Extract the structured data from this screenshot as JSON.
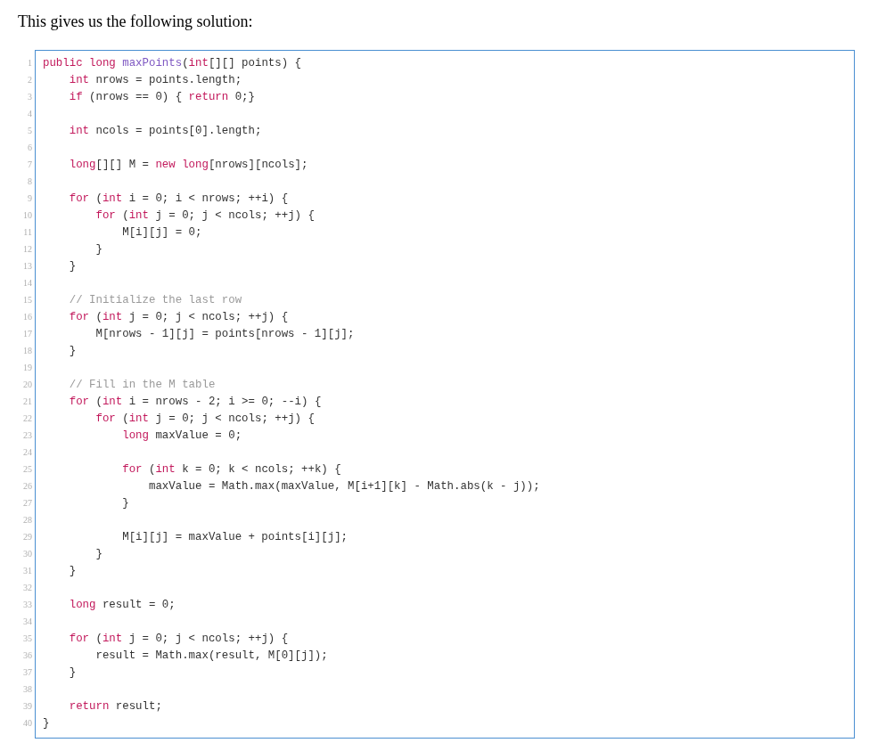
{
  "heading": "This gives us the following solution:",
  "code": {
    "lines": [
      {
        "number": "1",
        "tokens": [
          {
            "kind": "keyword",
            "text": "public"
          },
          {
            "kind": "keyword",
            "text": " long"
          },
          {
            "kind": "function",
            "text": " maxPoints"
          },
          {
            "kind": "plain",
            "text": "("
          },
          {
            "kind": "keyword",
            "text": "int"
          },
          {
            "kind": "plain",
            "text": "[][] points) {"
          }
        ]
      },
      {
        "number": "2",
        "tokens": [
          {
            "kind": "keyword",
            "text": "    int"
          },
          {
            "kind": "plain",
            "text": " nrows = points.length;"
          }
        ]
      },
      {
        "number": "3",
        "tokens": [
          {
            "kind": "keyword",
            "text": "    if"
          },
          {
            "kind": "plain",
            "text": " (nrows == 0) { "
          },
          {
            "kind": "keyword",
            "text": "return"
          },
          {
            "kind": "plain",
            "text": " 0;}"
          }
        ]
      },
      {
        "number": "4"
      },
      {
        "number": "5",
        "tokens": [
          {
            "kind": "keyword",
            "text": "    int"
          },
          {
            "kind": "plain",
            "text": " ncols = points[0].length;"
          }
        ]
      },
      {
        "number": "6"
      },
      {
        "number": "7",
        "tokens": [
          {
            "kind": "keyword",
            "text": "    long"
          },
          {
            "kind": "plain",
            "text": "[][] M = "
          },
          {
            "kind": "keyword",
            "text": "new"
          },
          {
            "kind": "keyword",
            "text": " long"
          },
          {
            "kind": "plain",
            "text": "[nrows][ncols];"
          }
        ]
      },
      {
        "number": "8"
      },
      {
        "number": "9",
        "tokens": [
          {
            "kind": "keyword",
            "text": "    for"
          },
          {
            "kind": "plain",
            "text": " ("
          },
          {
            "kind": "keyword",
            "text": "int"
          },
          {
            "kind": "plain",
            "text": " i = 0; i < nrows; ++i) {"
          }
        ]
      },
      {
        "number": "10",
        "tokens": [
          {
            "kind": "keyword",
            "text": "        for"
          },
          {
            "kind": "plain",
            "text": " ("
          },
          {
            "kind": "keyword",
            "text": "int"
          },
          {
            "kind": "plain",
            "text": " j = 0; j < ncols; ++j) {"
          }
        ]
      },
      {
        "number": "11",
        "tokens": [
          {
            "kind": "plain",
            "text": "            M[i][j] = 0;"
          }
        ]
      },
      {
        "number": "12",
        "tokens": [
          {
            "kind": "plain",
            "text": "        }"
          }
        ]
      },
      {
        "number": "13",
        "tokens": [
          {
            "kind": "plain",
            "text": "    }"
          }
        ]
      },
      {
        "number": "14"
      },
      {
        "number": "15",
        "tokens": [
          {
            "kind": "comment",
            "text": "    // Initialize the last row"
          }
        ]
      },
      {
        "number": "16",
        "tokens": [
          {
            "kind": "keyword",
            "text": "    for"
          },
          {
            "kind": "plain",
            "text": " ("
          },
          {
            "kind": "keyword",
            "text": "int"
          },
          {
            "kind": "plain",
            "text": " j = 0; j < ncols; ++j) {"
          }
        ]
      },
      {
        "number": "17",
        "tokens": [
          {
            "kind": "plain",
            "text": "        M[nrows - 1][j] = points[nrows - 1][j];"
          }
        ]
      },
      {
        "number": "18",
        "tokens": [
          {
            "kind": "plain",
            "text": "    }"
          }
        ]
      },
      {
        "number": "19"
      },
      {
        "number": "20",
        "tokens": [
          {
            "kind": "comment",
            "text": "    // Fill in the M table"
          }
        ]
      },
      {
        "number": "21",
        "tokens": [
          {
            "kind": "keyword",
            "text": "    for"
          },
          {
            "kind": "plain",
            "text": " ("
          },
          {
            "kind": "keyword",
            "text": "int"
          },
          {
            "kind": "plain",
            "text": " i = nrows - 2; i >= 0; --i) {"
          }
        ]
      },
      {
        "number": "22",
        "tokens": [
          {
            "kind": "keyword",
            "text": "        for"
          },
          {
            "kind": "plain",
            "text": " ("
          },
          {
            "kind": "keyword",
            "text": "int"
          },
          {
            "kind": "plain",
            "text": " j = 0; j < ncols; ++j) {"
          }
        ]
      },
      {
        "number": "23",
        "tokens": [
          {
            "kind": "keyword",
            "text": "            long"
          },
          {
            "kind": "plain",
            "text": " maxValue = 0;"
          }
        ]
      },
      {
        "number": "24"
      },
      {
        "number": "25",
        "tokens": [
          {
            "kind": "keyword",
            "text": "            for"
          },
          {
            "kind": "plain",
            "text": " ("
          },
          {
            "kind": "keyword",
            "text": "int"
          },
          {
            "kind": "plain",
            "text": " k = 0; k < ncols; ++k) {"
          }
        ]
      },
      {
        "number": "26",
        "tokens": [
          {
            "kind": "plain",
            "text": "                maxValue = Math.max(maxValue, M[i+1][k] - Math.abs(k - j));"
          }
        ]
      },
      {
        "number": "27",
        "tokens": [
          {
            "kind": "plain",
            "text": "            }"
          }
        ]
      },
      {
        "number": "28"
      },
      {
        "number": "29",
        "tokens": [
          {
            "kind": "plain",
            "text": "            M[i][j] = maxValue + points[i][j];"
          }
        ]
      },
      {
        "number": "30",
        "tokens": [
          {
            "kind": "plain",
            "text": "        }"
          }
        ]
      },
      {
        "number": "31",
        "tokens": [
          {
            "kind": "plain",
            "text": "    }"
          }
        ]
      },
      {
        "number": "32"
      },
      {
        "number": "33",
        "tokens": [
          {
            "kind": "keyword",
            "text": "    long"
          },
          {
            "kind": "plain",
            "text": " result = 0;"
          }
        ]
      },
      {
        "number": "34"
      },
      {
        "number": "35",
        "tokens": [
          {
            "kind": "keyword",
            "text": "    for"
          },
          {
            "kind": "plain",
            "text": " ("
          },
          {
            "kind": "keyword",
            "text": "int"
          },
          {
            "kind": "plain",
            "text": " j = 0; j < ncols; ++j) {"
          }
        ]
      },
      {
        "number": "36",
        "tokens": [
          {
            "kind": "plain",
            "text": "        result = Math.max(result, M[0][j]);"
          }
        ]
      },
      {
        "number": "37",
        "tokens": [
          {
            "kind": "plain",
            "text": "    }"
          }
        ]
      },
      {
        "number": "38"
      },
      {
        "number": "39",
        "tokens": [
          {
            "kind": "keyword",
            "text": "    return"
          },
          {
            "kind": "plain",
            "text": " result;"
          }
        ]
      },
      {
        "number": "40",
        "tokens": [
          {
            "kind": "plain",
            "text": "}"
          }
        ]
      }
    ]
  }
}
